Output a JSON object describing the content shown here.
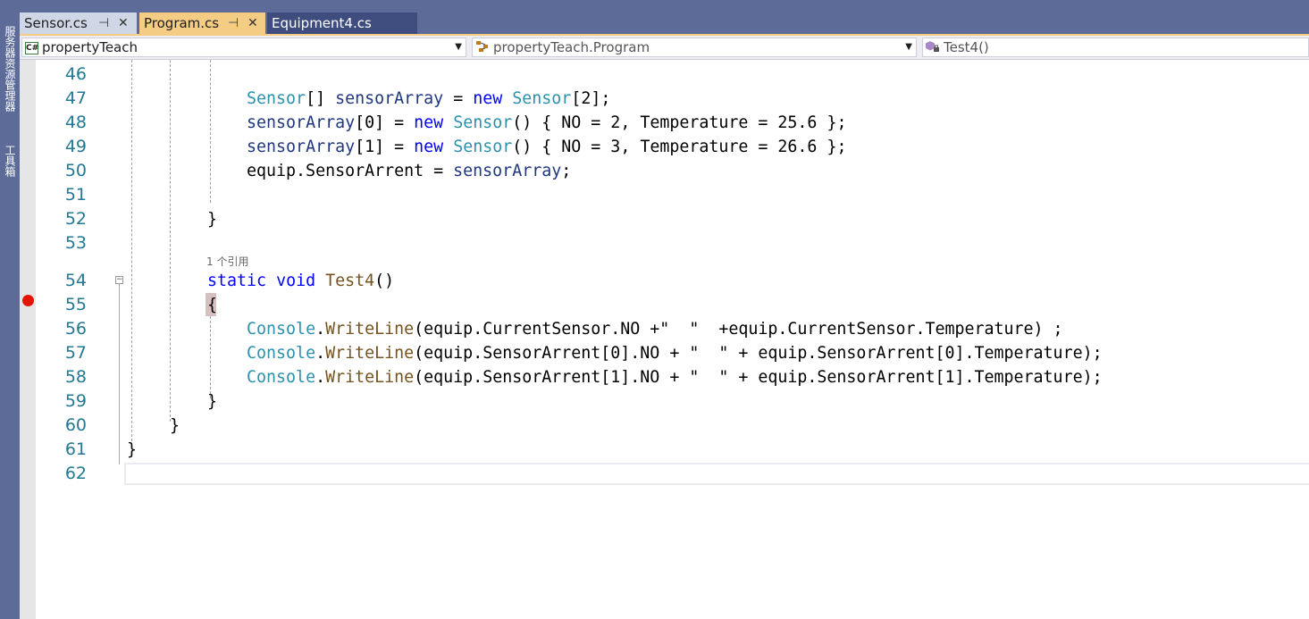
{
  "tabs": [
    {
      "label": "Sensor.cs",
      "pin": "⊣",
      "close": "✕",
      "state": "inactive"
    },
    {
      "label": "Program.cs",
      "pin": "⊣",
      "close": "✕",
      "state": "active"
    },
    {
      "label": "Equipment4.cs",
      "state": "preview"
    }
  ],
  "left_panel": {
    "tab1": "服务器资源管理器",
    "tab2": "工具箱"
  },
  "navbar": {
    "project": "propertyTeach",
    "class": "propertyTeach.Program",
    "member": "Test4()",
    "cs_badge": "C#"
  },
  "editor": {
    "line_numbers": [
      "46",
      "47",
      "48",
      "49",
      "50",
      "51",
      "52",
      "53",
      "54",
      "55",
      "56",
      "57",
      "58",
      "59",
      "60",
      "61",
      "62"
    ],
    "codelens": "1 个引用",
    "breakpoint_line": "55"
  },
  "colors": {
    "chrome": "#5d6b99",
    "active_tab": "#f5cc84",
    "keyword": "#0000ff",
    "type": "#2b91af",
    "method": "#74531f",
    "variable": "#1f377f",
    "line_number": "#237893",
    "breakpoint": "#e51400"
  },
  "icons": [
    "pin-icon",
    "close-icon",
    "csharp-file-icon",
    "class-icon",
    "method-icon",
    "chevron-down-icon",
    "breakpoint-icon",
    "collapse-icon"
  ]
}
